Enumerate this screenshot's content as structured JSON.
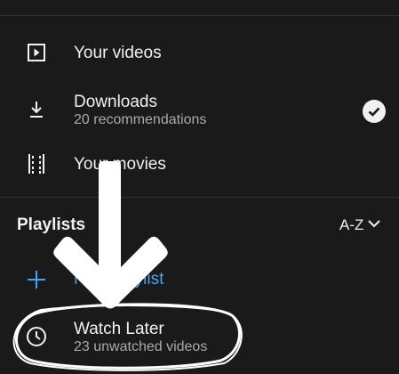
{
  "menu": {
    "your_videos": {
      "title": "Your videos",
      "icon": "play-square-icon"
    },
    "downloads": {
      "title": "Downloads",
      "subtitle": "20 recommendations",
      "icon": "download-icon",
      "status_icon": "check-circle-icon"
    },
    "your_movies": {
      "title": "Your movies",
      "icon": "film-strip-icon"
    }
  },
  "playlists": {
    "section_title": "Playlists",
    "sort_label": "A-Z",
    "new_playlist": {
      "label": "New playlist",
      "icon": "plus-icon",
      "color": "#3ea6ff"
    },
    "items": [
      {
        "title": "Watch Later",
        "subtitle": "23 unwatched videos",
        "icon": "clock-icon"
      }
    ]
  },
  "colors": {
    "background": "#1a1a1a",
    "text": "#f1f1f1",
    "secondary_text": "#aaaaaa",
    "accent": "#3ea6ff",
    "annotation": "#ffffff"
  },
  "annotation": {
    "arrow_icon": "down-arrow-icon",
    "highlight": "hand-drawn-circle-around-watch-later"
  }
}
